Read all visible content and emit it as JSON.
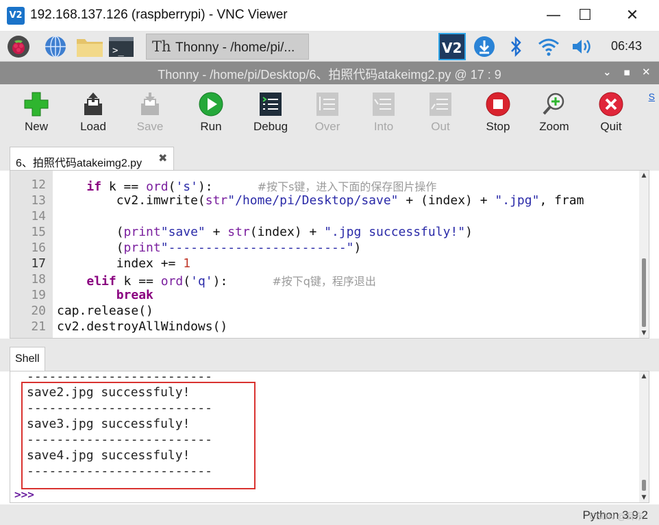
{
  "vnc_window": {
    "title": "192.168.137.126 (raspberrypi) - VNC Viewer",
    "logo_text": "V2",
    "controls": {
      "minimize": "—",
      "maximize": "☐",
      "close": "✕"
    }
  },
  "panel": {
    "task_label": "Thonny  -  /home/pi/...",
    "clock": "06:43",
    "icons": [
      "raspberry-menu-icon",
      "web-browser-icon",
      "file-manager-icon",
      "terminal-icon",
      "vnc-server-icon",
      "download-icon",
      "bluetooth-icon",
      "wifi-icon",
      "volume-icon"
    ]
  },
  "thonny": {
    "title": "Thonny  -  /home/pi/Desktop/6、拍照代码atakeimg2.py  @  17 : 9",
    "title_controls": {
      "menu": "⌄",
      "maximize": "▪",
      "close": "✕"
    }
  },
  "toolbar": {
    "buttons": [
      {
        "label": "New",
        "enabled": true
      },
      {
        "label": "Load",
        "enabled": true
      },
      {
        "label": "Save",
        "enabled": false
      },
      {
        "label": "Run",
        "enabled": true
      },
      {
        "label": "Debug",
        "enabled": true
      },
      {
        "label": "Over",
        "enabled": false
      },
      {
        "label": "Into",
        "enabled": false
      },
      {
        "label": "Out",
        "enabled": false
      },
      {
        "label": "Stop",
        "enabled": true
      },
      {
        "label": "Zoom",
        "enabled": true
      },
      {
        "label": "Quit",
        "enabled": true
      }
    ],
    "extra_link": "S"
  },
  "editor": {
    "tab_label": "6、拍照代码atakeimg2.py",
    "tab_close": "✖",
    "current_line": "17",
    "lines": [
      {
        "n": "12",
        "indent": "    ",
        "kw": "if",
        "text": " k == ",
        "fn": "ord",
        "rest": "(",
        "str": "'s'",
        "tail": "):      ",
        "cmt": "#按下s键，进入下面的保存图片操作"
      },
      {
        "n": "13",
        "indent": "        ",
        "plain1": "cv2.imwrite(",
        "str": "\"/home/pi/Desktop/save\"",
        "plain2": " + ",
        "fn": "str",
        "plain3": "(index) + ",
        "str2": "\".jpg\"",
        "plain4": ", fram"
      },
      {
        "n": "14"
      },
      {
        "n": "15",
        "indent": "        ",
        "fn": "print",
        "plain1": "(",
        "str": "\"save\"",
        "plain2": " + ",
        "fn2": "str",
        "plain3": "(index) + ",
        "str2": "\".jpg successfuly!\"",
        "plain4": ")"
      },
      {
        "n": "16",
        "indent": "        ",
        "fn": "print",
        "plain1": "(",
        "str": "\"------------------------\"",
        "plain4": ")"
      },
      {
        "n": "17",
        "indent": "        ",
        "plain1": "index += ",
        "num": "1"
      },
      {
        "n": "18",
        "indent": "    ",
        "kw": "elif",
        "text": " k == ",
        "fn": "ord",
        "rest": "(",
        "str": "'q'",
        "tail": "):      ",
        "cmt": "#按下q键，程序退出"
      },
      {
        "n": "19",
        "indent": "        ",
        "kw": "break"
      },
      {
        "n": "20",
        "plain1": "cap.release()"
      },
      {
        "n": "21",
        "plain1": "cv2.destroyAllWindows()"
      }
    ]
  },
  "shell": {
    "tab_label": "Shell",
    "lines": [
      "-------------------------",
      "save2.jpg successfuly!",
      "-------------------------",
      "save3.jpg successfuly!",
      "-------------------------",
      "save4.jpg successfuly!",
      "-------------------------"
    ],
    "prompt": ">>>"
  },
  "status": {
    "python_version": "Python 3.9.2",
    "watermark": "CSDN @耳东"
  },
  "colors": {
    "thonny_title_bg": "#8b8b8b",
    "toolbar_bg": "#e8e8e8",
    "keyword": "#8a0080",
    "string": "#2a2aa8",
    "number": "#c0392b",
    "comment": "#9a9a9a",
    "highlight_box": "#d9322f",
    "prompt": "#6b1fa0"
  }
}
